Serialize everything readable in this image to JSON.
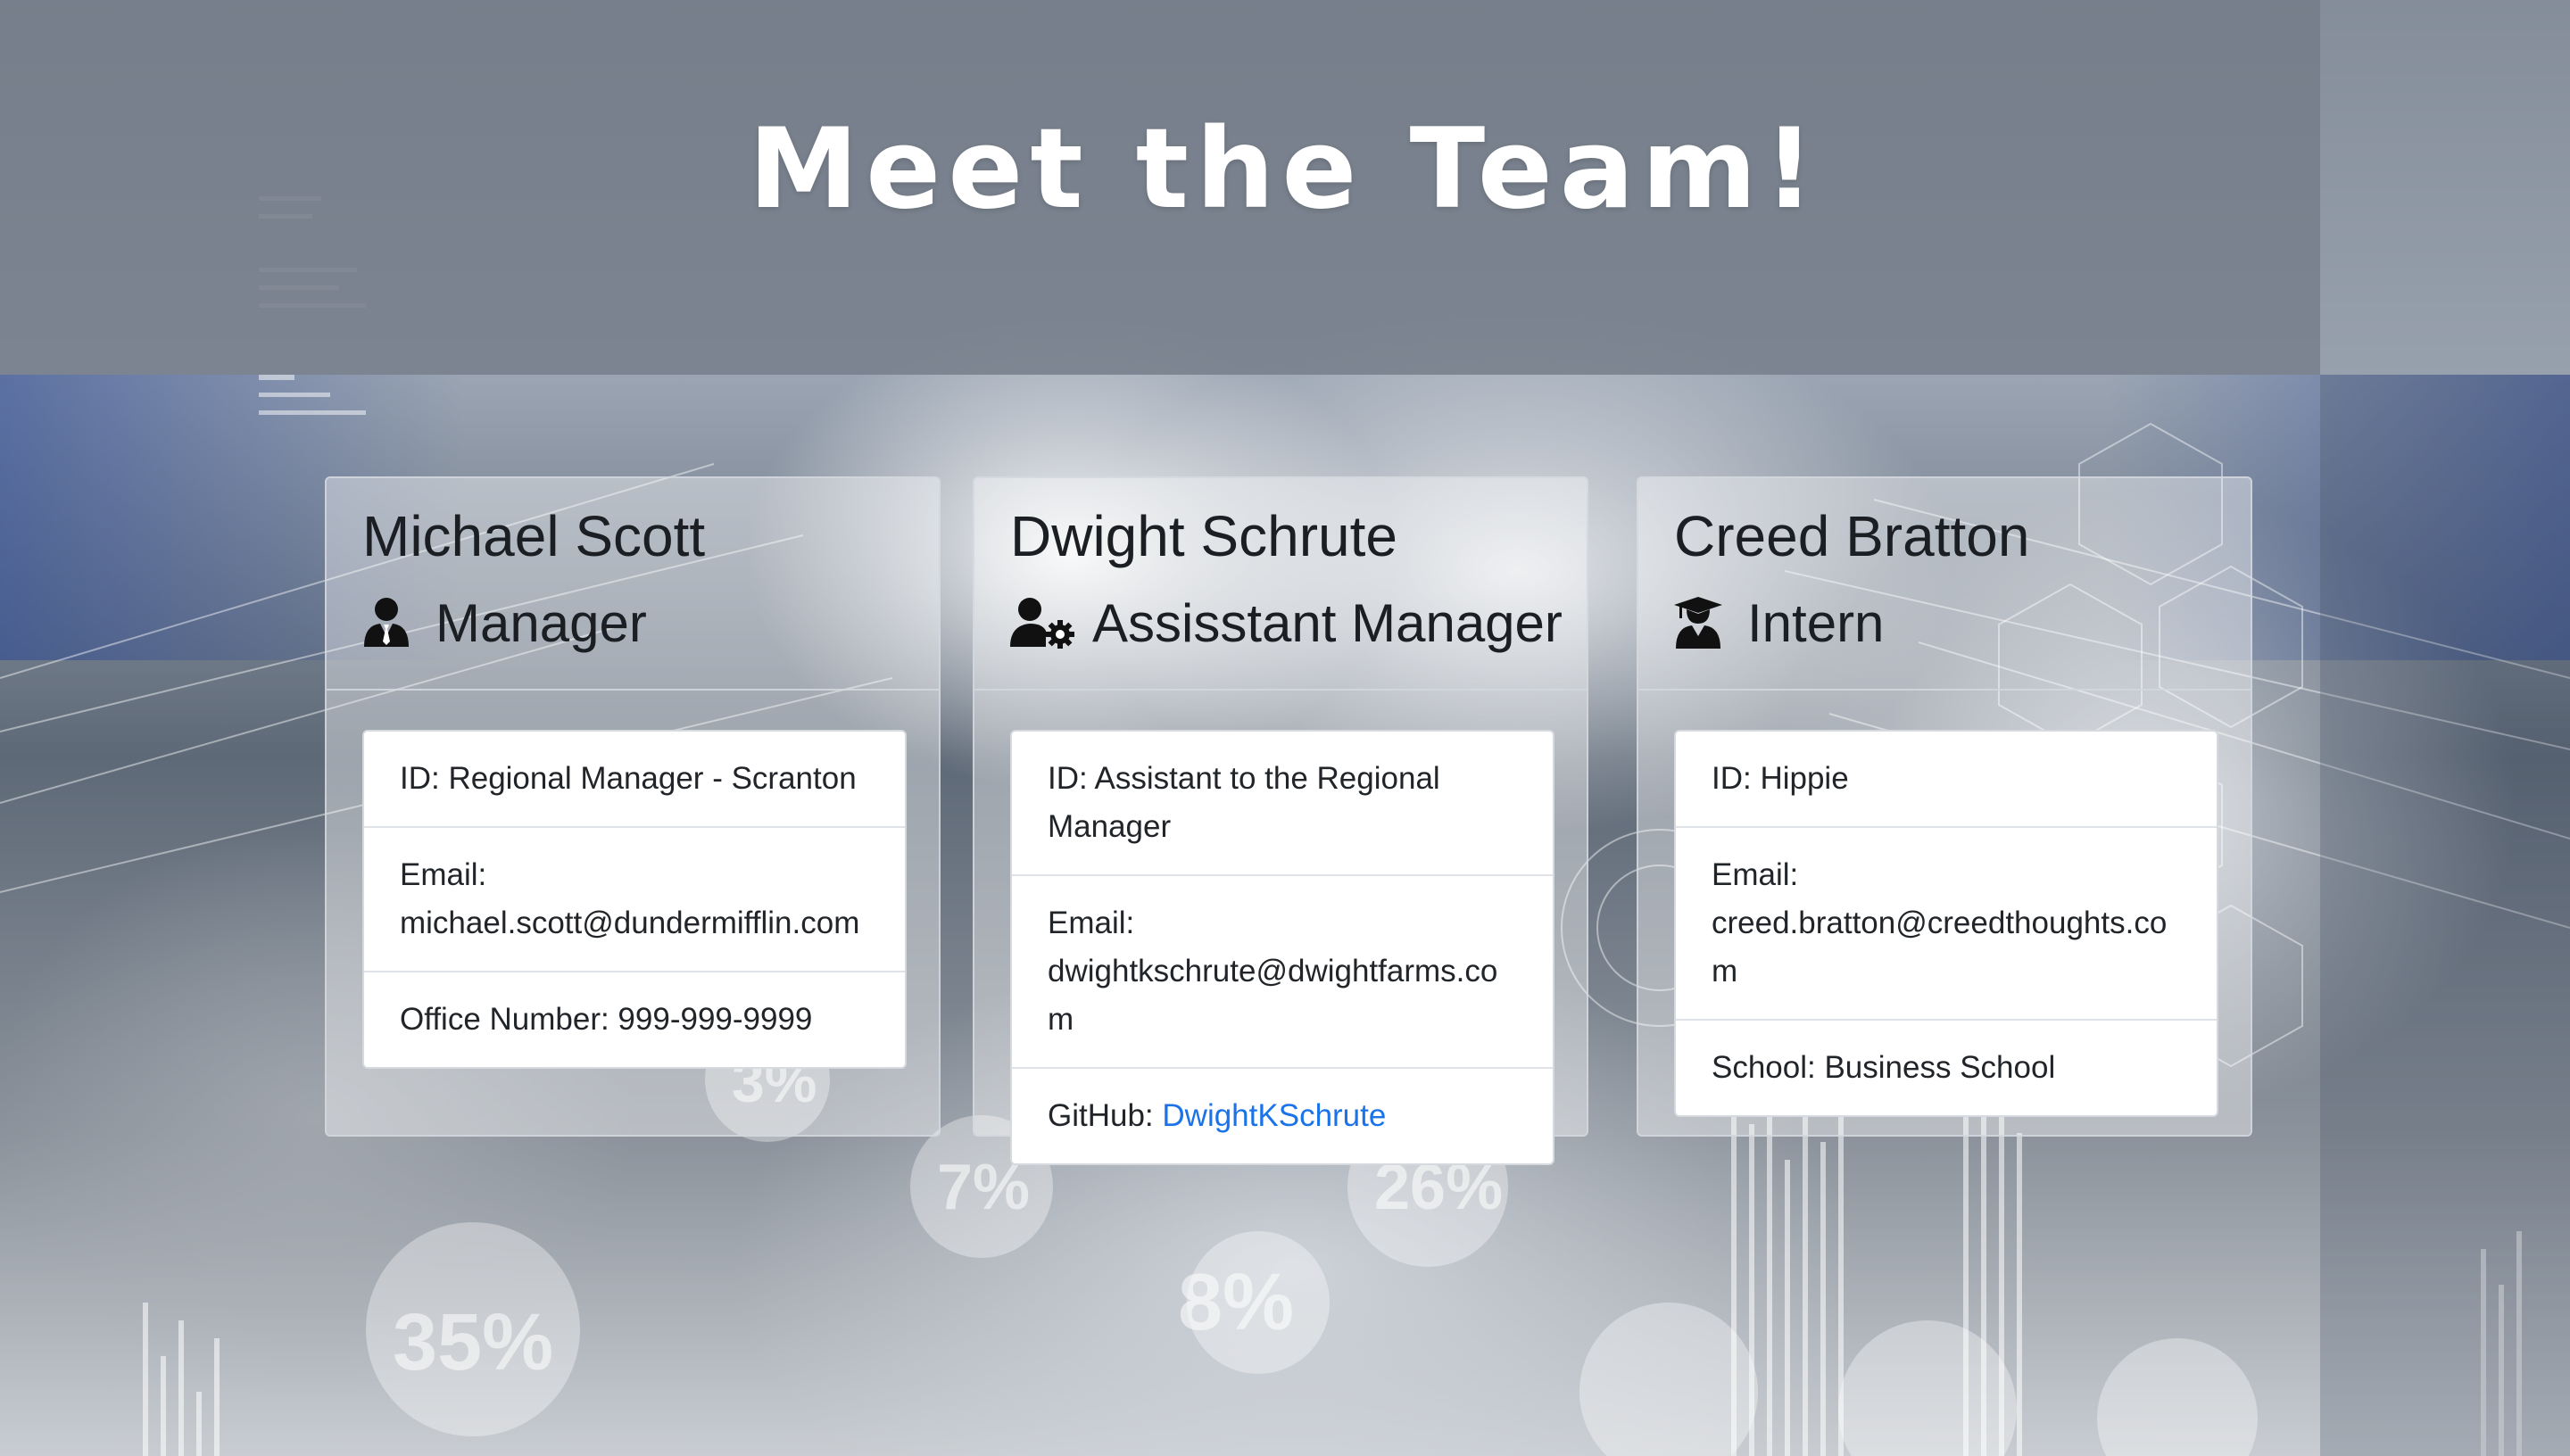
{
  "page": {
    "title": "Meet the Team!"
  },
  "team": [
    {
      "name": "Michael Scott",
      "role": "Manager",
      "role_icon": "user-tie-icon",
      "details": [
        {
          "text": "ID: Regional Manager - Scranton"
        },
        {
          "text": "Email: michael.scott@dundermifflin.com"
        },
        {
          "text": "Office Number: 999-999-9999"
        }
      ]
    },
    {
      "name": "Dwight Schrute",
      "role": "Assisstant Manager",
      "role_icon": "user-cog-icon",
      "details": [
        {
          "text": "ID: Assistant to the Regional Manager"
        },
        {
          "text": "Email: dwightkschrute@dwightfarms.com"
        },
        {
          "prefix": "GitHub: ",
          "link": "DwightKSchrute"
        }
      ]
    },
    {
      "name": "Creed Bratton",
      "role": "Intern",
      "role_icon": "user-graduate-icon",
      "details": [
        {
          "text": "ID: Hippie"
        },
        {
          "text": "Email: creed.bratton@creedthoughts.com"
        },
        {
          "text": "School: Business School"
        }
      ]
    }
  ],
  "background": {
    "stat_labels": [
      "3%",
      "7%",
      "26%",
      "35%",
      "8%"
    ]
  },
  "colors": {
    "link": "#1a73e8",
    "header_band": "#78808c",
    "text": "#1b1f24"
  }
}
